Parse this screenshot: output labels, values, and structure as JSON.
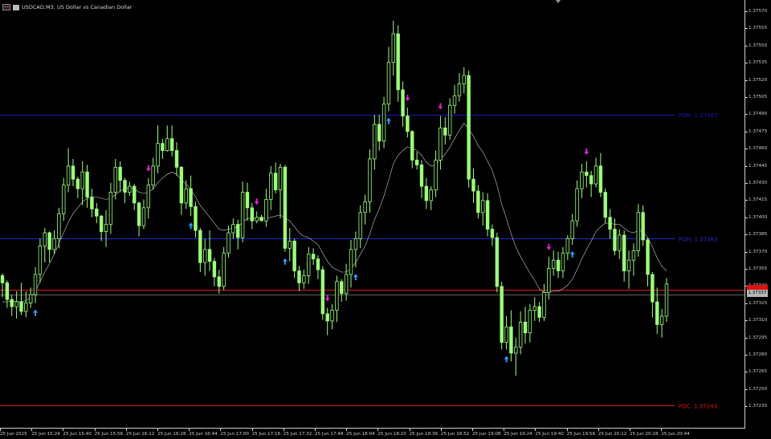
{
  "window": {
    "title": "USDCAD,M3: US Dollar vs Canadian Dollar",
    "chart_icon": "chart-window-icon",
    "bars_icon": "bar-chart-icon"
  },
  "levels": [
    {
      "id": "pdh-upper",
      "label": "PDH: 1.37487",
      "price": 1.37487,
      "color": "#1a1ab0"
    },
    {
      "id": "pdh",
      "label": "PDH: 1.37383",
      "price": 1.37383,
      "color": "#2a2ad0"
    },
    {
      "id": "pdc",
      "label": "PDC: 1.37243",
      "price": 1.37243,
      "color": "#e01818"
    },
    {
      "id": "current",
      "label": "",
      "price": 1.3734,
      "color": "#e01818"
    },
    {
      "id": "bid",
      "label": "",
      "price": 1.37336,
      "color": "#606060"
    }
  ],
  "price_axis": {
    "labels": [
      "1.37570",
      "1.37555",
      "1.37550",
      "1.37535",
      "1.37520",
      "1.37505",
      "1.37490",
      "1.37475",
      "1.37460",
      "1.37445",
      "1.37430",
      "1.37415",
      "1.37400",
      "1.37385",
      "1.37370",
      "1.37355",
      "1.37340",
      "1.37325",
      "1.37310",
      "1.37295",
      "1.37280",
      "1.37265",
      "1.37250",
      "1.37235"
    ],
    "current": "1.37337"
  },
  "time_axis": {
    "labels": [
      "25 Jun 2025",
      "25 Jun 15:24",
      "25 Jun 15:40",
      "25 Jun 15:56",
      "25 Jun 16:12",
      "25 Jun 16:28",
      "25 Jun 16:44",
      "25 Jun 17:00",
      "25 Jun 17:16",
      "25 Jun 17:32",
      "25 Jun 17:48",
      "25 Jun 18:04",
      "25 Jun 18:20",
      "25 Jun 18:36",
      "25 Jun 18:52",
      "25 Jun 19:08",
      "25 Jun 19:24",
      "25 Jun 19:40",
      "25 Jun 19:56",
      "25 Jun 20:12",
      "25 Jun 20:28",
      "25 Jun 20:44"
    ]
  },
  "chart_data": {
    "type": "candlestick",
    "symbol": "USDCAD",
    "timeframe": "M3",
    "price_range": [
      1.37225,
      1.3758
    ],
    "bar_color": "#9cff7a",
    "candles": [
      [
        1.37352,
        1.37354,
        1.37334,
        1.37346
      ],
      [
        1.37346,
        1.37348,
        1.37325,
        1.37332
      ],
      [
        1.37332,
        1.37336,
        1.37318,
        1.37326
      ],
      [
        1.37326,
        1.37339,
        1.37316,
        1.3733
      ],
      [
        1.3733,
        1.37346,
        1.37319,
        1.37322
      ],
      [
        1.37322,
        1.37339,
        1.37317,
        1.37329
      ],
      [
        1.37329,
        1.37342,
        1.37325,
        1.37336
      ],
      [
        1.37336,
        1.37359,
        1.37329,
        1.37353
      ],
      [
        1.37353,
        1.37383,
        1.37346,
        1.37377
      ],
      [
        1.37377,
        1.37392,
        1.37363,
        1.37388
      ],
      [
        1.37388,
        1.37389,
        1.37363,
        1.37374
      ],
      [
        1.37374,
        1.3739,
        1.3737,
        1.37383
      ],
      [
        1.37383,
        1.37409,
        1.37375,
        1.37404
      ],
      [
        1.37404,
        1.37434,
        1.37398,
        1.37428
      ],
      [
        1.37428,
        1.37459,
        1.37422,
        1.37444
      ],
      [
        1.37444,
        1.3745,
        1.37427,
        1.37433
      ],
      [
        1.37433,
        1.37435,
        1.37417,
        1.37425
      ],
      [
        1.37425,
        1.37448,
        1.37411,
        1.37439
      ],
      [
        1.37439,
        1.37445,
        1.37409,
        1.37418
      ],
      [
        1.37418,
        1.37425,
        1.37401,
        1.37408
      ],
      [
        1.37408,
        1.37413,
        1.37396,
        1.37402
      ],
      [
        1.37402,
        1.37403,
        1.37381,
        1.37389
      ],
      [
        1.37389,
        1.37407,
        1.37376,
        1.37395
      ],
      [
        1.37395,
        1.3743,
        1.37387,
        1.37422
      ],
      [
        1.37422,
        1.3745,
        1.37416,
        1.37443
      ],
      [
        1.37443,
        1.37448,
        1.37422,
        1.37432
      ],
      [
        1.37432,
        1.37434,
        1.37413,
        1.37422
      ],
      [
        1.37422,
        1.37431,
        1.37419,
        1.37427
      ],
      [
        1.37427,
        1.37429,
        1.37407,
        1.37413
      ],
      [
        1.37413,
        1.37414,
        1.37385,
        1.37394
      ],
      [
        1.37394,
        1.37416,
        1.37391,
        1.37409
      ],
      [
        1.37409,
        1.37434,
        1.374,
        1.37428
      ],
      [
        1.37428,
        1.37451,
        1.37424,
        1.37444
      ],
      [
        1.37444,
        1.37478,
        1.37438,
        1.37463
      ],
      [
        1.37463,
        1.37467,
        1.3745,
        1.37457
      ],
      [
        1.37457,
        1.37478,
        1.37456,
        1.37467
      ],
      [
        1.37467,
        1.37478,
        1.37452,
        1.37457
      ],
      [
        1.37457,
        1.37464,
        1.37436,
        1.37443
      ],
      [
        1.37443,
        1.37444,
        1.37403,
        1.37413
      ],
      [
        1.37413,
        1.37432,
        1.37408,
        1.37425
      ],
      [
        1.37425,
        1.37436,
        1.37402,
        1.3741
      ],
      [
        1.3741,
        1.37414,
        1.37384,
        1.3739
      ],
      [
        1.3739,
        1.37392,
        1.37355,
        1.37363
      ],
      [
        1.37363,
        1.37383,
        1.37352,
        1.37374
      ],
      [
        1.37374,
        1.3739,
        1.37356,
        1.37364
      ],
      [
        1.37364,
        1.37367,
        1.37343,
        1.37351
      ],
      [
        1.37351,
        1.37357,
        1.37337,
        1.37343
      ],
      [
        1.37343,
        1.37376,
        1.3734,
        1.37371
      ],
      [
        1.37371,
        1.37394,
        1.37367,
        1.37388
      ],
      [
        1.37388,
        1.374,
        1.37383,
        1.37395
      ],
      [
        1.37395,
        1.37399,
        1.37374,
        1.37384
      ],
      [
        1.37384,
        1.37431,
        1.3738,
        1.37422
      ],
      [
        1.37422,
        1.3743,
        1.37398,
        1.37409
      ],
      [
        1.37409,
        1.37413,
        1.37391,
        1.37398
      ],
      [
        1.37398,
        1.37406,
        1.37396,
        1.37401
      ],
      [
        1.37401,
        1.37403,
        1.37398,
        1.37398
      ],
      [
        1.37398,
        1.37425,
        1.37393,
        1.37416
      ],
      [
        1.37416,
        1.37444,
        1.37407,
        1.37438
      ],
      [
        1.37438,
        1.37447,
        1.37421,
        1.37424
      ],
      [
        1.37424,
        1.37446,
        1.374,
        1.37443
      ],
      [
        1.37443,
        1.37445,
        1.37372,
        1.37375
      ],
      [
        1.37375,
        1.37392,
        1.37364,
        1.37381
      ],
      [
        1.37381,
        1.37383,
        1.3735,
        1.37356
      ],
      [
        1.37356,
        1.3736,
        1.37339,
        1.37346
      ],
      [
        1.37346,
        1.37357,
        1.37341,
        1.37352
      ],
      [
        1.37352,
        1.37376,
        1.37345,
        1.3737
      ],
      [
        1.3737,
        1.37375,
        1.37361,
        1.37366
      ],
      [
        1.37366,
        1.37369,
        1.37349,
        1.37357
      ],
      [
        1.37357,
        1.3736,
        1.37315,
        1.3732
      ],
      [
        1.3732,
        1.37325,
        1.37302,
        1.37314
      ],
      [
        1.37314,
        1.37328,
        1.37307,
        1.37323
      ],
      [
        1.37323,
        1.37352,
        1.37313,
        1.37347
      ],
      [
        1.37347,
        1.37349,
        1.3733,
        1.37337
      ],
      [
        1.37337,
        1.37362,
        1.37331,
        1.37353
      ],
      [
        1.37353,
        1.37382,
        1.37342,
        1.37374
      ],
      [
        1.37374,
        1.37389,
        1.37359,
        1.37383
      ],
      [
        1.37383,
        1.37411,
        1.37375,
        1.37405
      ],
      [
        1.37405,
        1.3742,
        1.37395,
        1.37414
      ],
      [
        1.37414,
        1.37458,
        1.37405,
        1.3745
      ],
      [
        1.3745,
        1.37487,
        1.37441,
        1.37479
      ],
      [
        1.37479,
        1.37487,
        1.37457,
        1.37465
      ],
      [
        1.37465,
        1.37502,
        1.37459,
        1.37496
      ],
      [
        1.37496,
        1.37544,
        1.3749,
        1.37531
      ],
      [
        1.37531,
        1.37566,
        1.3752,
        1.37555
      ],
      [
        1.37555,
        1.37562,
        1.37498,
        1.37508
      ],
      [
        1.37508,
        1.37515,
        1.37477,
        1.37486
      ],
      [
        1.37486,
        1.37493,
        1.37468,
        1.37473
      ],
      [
        1.37473,
        1.37474,
        1.37442,
        1.37449
      ],
      [
        1.37449,
        1.37456,
        1.37441,
        1.37445
      ],
      [
        1.37445,
        1.37449,
        1.37417,
        1.37427
      ],
      [
        1.37427,
        1.37434,
        1.37408,
        1.37415
      ],
      [
        1.37415,
        1.37427,
        1.37407,
        1.37424
      ],
      [
        1.37424,
        1.37457,
        1.37418,
        1.37449
      ],
      [
        1.37449,
        1.37486,
        1.37441,
        1.37476
      ],
      [
        1.37476,
        1.37485,
        1.37462,
        1.3747
      ],
      [
        1.3747,
        1.37501,
        1.37466,
        1.37495
      ],
      [
        1.37495,
        1.37512,
        1.37488,
        1.37503
      ],
      [
        1.37503,
        1.37522,
        1.37498,
        1.37513
      ],
      [
        1.37513,
        1.37527,
        1.37505,
        1.3752
      ],
      [
        1.3752,
        1.37524,
        1.37426,
        1.37433
      ],
      [
        1.37433,
        1.37442,
        1.37413,
        1.37423
      ],
      [
        1.37423,
        1.37428,
        1.374,
        1.37405
      ],
      [
        1.37405,
        1.37422,
        1.37394,
        1.37415
      ],
      [
        1.37415,
        1.37421,
        1.37385,
        1.37391
      ],
      [
        1.37391,
        1.37395,
        1.37377,
        1.37384
      ],
      [
        1.37384,
        1.37388,
        1.37338,
        1.37343
      ],
      [
        1.37343,
        1.37347,
        1.3729,
        1.37296
      ],
      [
        1.37296,
        1.37318,
        1.3729,
        1.37309
      ],
      [
        1.37309,
        1.37323,
        1.3728,
        1.37287
      ],
      [
        1.37287,
        1.373,
        1.37268,
        1.37292
      ],
      [
        1.37292,
        1.37322,
        1.37286,
        1.37313
      ],
      [
        1.37313,
        1.37326,
        1.37295,
        1.37304
      ],
      [
        1.37304,
        1.37328,
        1.37296,
        1.37323
      ],
      [
        1.37323,
        1.37334,
        1.37314,
        1.37326
      ],
      [
        1.37326,
        1.3733,
        1.37313,
        1.37317
      ],
      [
        1.37317,
        1.37345,
        1.37314,
        1.37338
      ],
      [
        1.37338,
        1.37368,
        1.37332,
        1.37358
      ],
      [
        1.37358,
        1.37373,
        1.37352,
        1.37365
      ],
      [
        1.37365,
        1.37372,
        1.3735,
        1.37356
      ],
      [
        1.37356,
        1.37376,
        1.3735,
        1.37371
      ],
      [
        1.37371,
        1.37386,
        1.37365,
        1.37383
      ],
      [
        1.37383,
        1.37404,
        1.37378,
        1.37398
      ],
      [
        1.37398,
        1.37432,
        1.37393,
        1.37425
      ],
      [
        1.37425,
        1.37446,
        1.37417,
        1.37439
      ],
      [
        1.37439,
        1.37448,
        1.37426,
        1.37436
      ],
      [
        1.37436,
        1.3744,
        1.37418,
        1.37429
      ],
      [
        1.37429,
        1.37451,
        1.37426,
        1.37444
      ],
      [
        1.37444,
        1.37455,
        1.37418,
        1.37422
      ],
      [
        1.37422,
        1.37425,
        1.37396,
        1.37401
      ],
      [
        1.37401,
        1.37408,
        1.37383,
        1.37391
      ],
      [
        1.37391,
        1.374,
        1.37369,
        1.37373
      ],
      [
        1.37373,
        1.37391,
        1.37366,
        1.37386
      ],
      [
        1.37386,
        1.3739,
        1.37347,
        1.37356
      ],
      [
        1.37356,
        1.37373,
        1.37341,
        1.37365
      ],
      [
        1.37365,
        1.37379,
        1.37352,
        1.37373
      ],
      [
        1.37373,
        1.37412,
        1.37368,
        1.37405
      ],
      [
        1.37405,
        1.37411,
        1.37377,
        1.37382
      ],
      [
        1.37382,
        1.37384,
        1.37343,
        1.37353
      ],
      [
        1.37353,
        1.37355,
        1.37317,
        1.3733
      ],
      [
        1.3733,
        1.37342,
        1.37303,
        1.37311
      ],
      [
        1.37311,
        1.37324,
        1.373,
        1.37318
      ],
      [
        1.37318,
        1.3735,
        1.37313,
        1.37345
      ]
    ],
    "moving_average": [
      1.3733,
      1.3733,
      1.37331,
      1.3733,
      1.3733,
      1.37331,
      1.37334,
      1.37339,
      1.37347,
      1.37355,
      1.37362,
      1.3737,
      1.37379,
      1.37388,
      1.37397,
      1.37404,
      1.37409,
      1.37414,
      1.37417,
      1.37418,
      1.37418,
      1.37417,
      1.37416,
      1.37417,
      1.3742,
      1.37423,
      1.37425,
      1.37426,
      1.37425,
      1.37422,
      1.37421,
      1.37422,
      1.37425,
      1.3743,
      1.37434,
      1.37437,
      1.37439,
      1.37437,
      1.37432,
      1.37429,
      1.37424,
      1.37418,
      1.37411,
      1.37406,
      1.37401,
      1.37396,
      1.37391,
      1.3739,
      1.37391,
      1.37392,
      1.37393,
      1.37397,
      1.374,
      1.374,
      1.374,
      1.374,
      1.374,
      1.37401,
      1.37402,
      1.37403,
      1.374,
      1.37398,
      1.37393,
      1.37388,
      1.37385,
      1.37384,
      1.37381,
      1.37378,
      1.37371,
      1.37364,
      1.37359,
      1.37357,
      1.37355,
      1.37355,
      1.37358,
      1.37363,
      1.3737,
      1.37377,
      1.37387,
      1.37399,
      1.37408,
      1.37419,
      1.37432,
      1.37446,
      1.37453,
      1.37457,
      1.3746,
      1.37459,
      1.37457,
      1.37453,
      1.37447,
      1.37444,
      1.37445,
      1.3745,
      1.37454,
      1.3746,
      1.37467,
      1.37474,
      1.3748,
      1.37475,
      1.37469,
      1.37461,
      1.37456,
      1.37448,
      1.3744,
      1.37428,
      1.37412,
      1.374,
      1.37387,
      1.37376,
      1.37368,
      1.37361,
      1.37354,
      1.37348,
      1.37341,
      1.37338,
      1.37338,
      1.37339,
      1.37339,
      1.37341,
      1.37344,
      1.37349,
      1.37357,
      1.37366,
      1.37374,
      1.37381,
      1.37389,
      1.37393,
      1.37396,
      1.37396,
      1.37395,
      1.37395,
      1.37392,
      1.37389,
      1.37388,
      1.3739,
      1.37389,
      1.37384,
      1.37376,
      1.37367,
      1.3736,
      1.37356
    ],
    "buy_arrows": [
      7,
      40,
      60,
      75,
      82,
      107,
      121
    ],
    "sell_arrows": [
      31,
      54,
      69,
      86,
      93,
      116,
      124
    ]
  }
}
